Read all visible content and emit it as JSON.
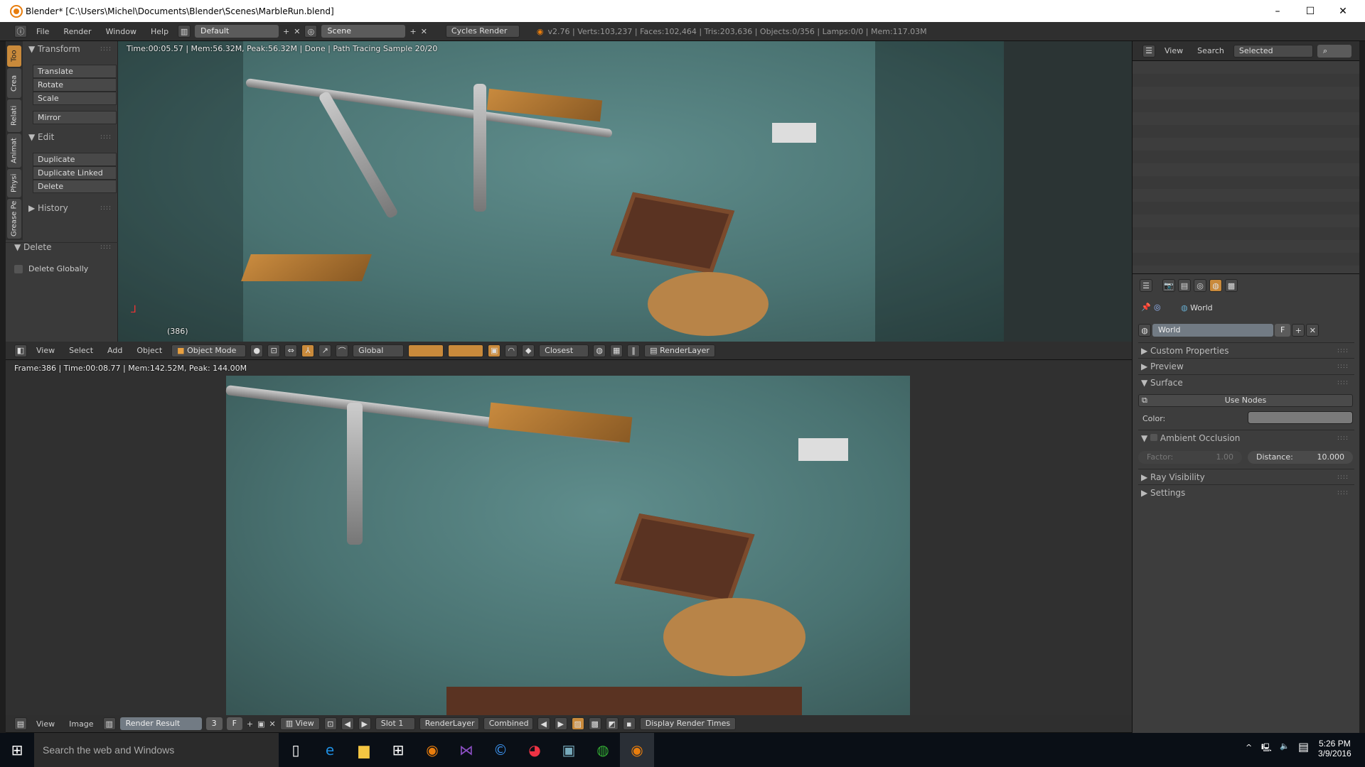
{
  "window": {
    "title": "Blender* [C:\\Users\\Michel\\Documents\\Blender\\Scenes\\MarbleRun.blend]",
    "minimize": "–",
    "maximize": "☐",
    "close": "✕"
  },
  "info_header": {
    "menus": [
      "File",
      "Render",
      "Window",
      "Help"
    ],
    "layout": "Default",
    "scene": "Scene",
    "engine": "Cycles Render",
    "stats": "v2.76 | Verts:103,237 | Faces:102,464 | Tris:203,636 | Objects:0/356 | Lamps:0/0 | Mem:117.03M"
  },
  "viewport": {
    "status": "Time:00:05.57 | Mem:56.32M, Peak:56.32M | Done | Path Tracing Sample 20/20",
    "frame_label": "(386)"
  },
  "tool_shelf": {
    "tabs": [
      "Too",
      "Crea",
      "Relati",
      "Animat",
      "Physi",
      "Grease Pe"
    ],
    "transform": {
      "title": "Transform",
      "buttons": [
        "Translate",
        "Rotate",
        "Scale",
        "Mirror"
      ]
    },
    "edit": {
      "title": "Edit",
      "buttons": [
        "Duplicate",
        "Duplicate Linked",
        "Delete"
      ]
    },
    "history": {
      "title": "History"
    },
    "operator": {
      "title": "Delete",
      "checkbox": "Delete Globally"
    }
  },
  "view3d_header": {
    "menus": [
      "View",
      "Select",
      "Add",
      "Object"
    ],
    "mode": "Object Mode",
    "orientation": "Global",
    "snap": "Closest",
    "render_layer": "RenderLayer"
  },
  "image_editor": {
    "status": "Frame:386 | Time:00:08.77 | Mem:142.52M, Peak: 144.00M"
  },
  "image_header": {
    "menus": [
      "View",
      "Image"
    ],
    "image": "Render Result",
    "users": "3",
    "fake": "F",
    "view": "View",
    "slot": "Slot 1",
    "layer": "RenderLayer",
    "pass": "Combined",
    "display_times": "Display Render Times"
  },
  "outliner": {
    "menus": [
      "View",
      "Search"
    ],
    "filter": "Selected"
  },
  "properties": {
    "breadcrumb": "World",
    "world_name": "World",
    "fake": "F",
    "sections": {
      "custom": "Custom Properties",
      "preview": "Preview",
      "surface": "Surface",
      "ao": "Ambient Occlusion",
      "ray": "Ray Visibility",
      "settings": "Settings"
    },
    "use_nodes": "Use Nodes",
    "color_label": "Color:",
    "color_value": "#7a7a7a",
    "factor_label": "Factor:",
    "factor_value": "1.00",
    "distance_label": "Distance:",
    "distance_value": "10.000"
  },
  "taskbar": {
    "search": "Search the web and Windows",
    "time": "5:26 PM",
    "date": "3/9/2016",
    "apps": [
      "task-view",
      "edge",
      "file-explorer",
      "store",
      "blender",
      "visual-studio",
      "app-c",
      "chrome",
      "app-window",
      "app-globe",
      "blender-active"
    ]
  },
  "colors": {
    "accent": "#c98a3b",
    "panel": "#3d3d3d",
    "header": "#2f2f2f",
    "taskbar": "#0a0f16"
  }
}
